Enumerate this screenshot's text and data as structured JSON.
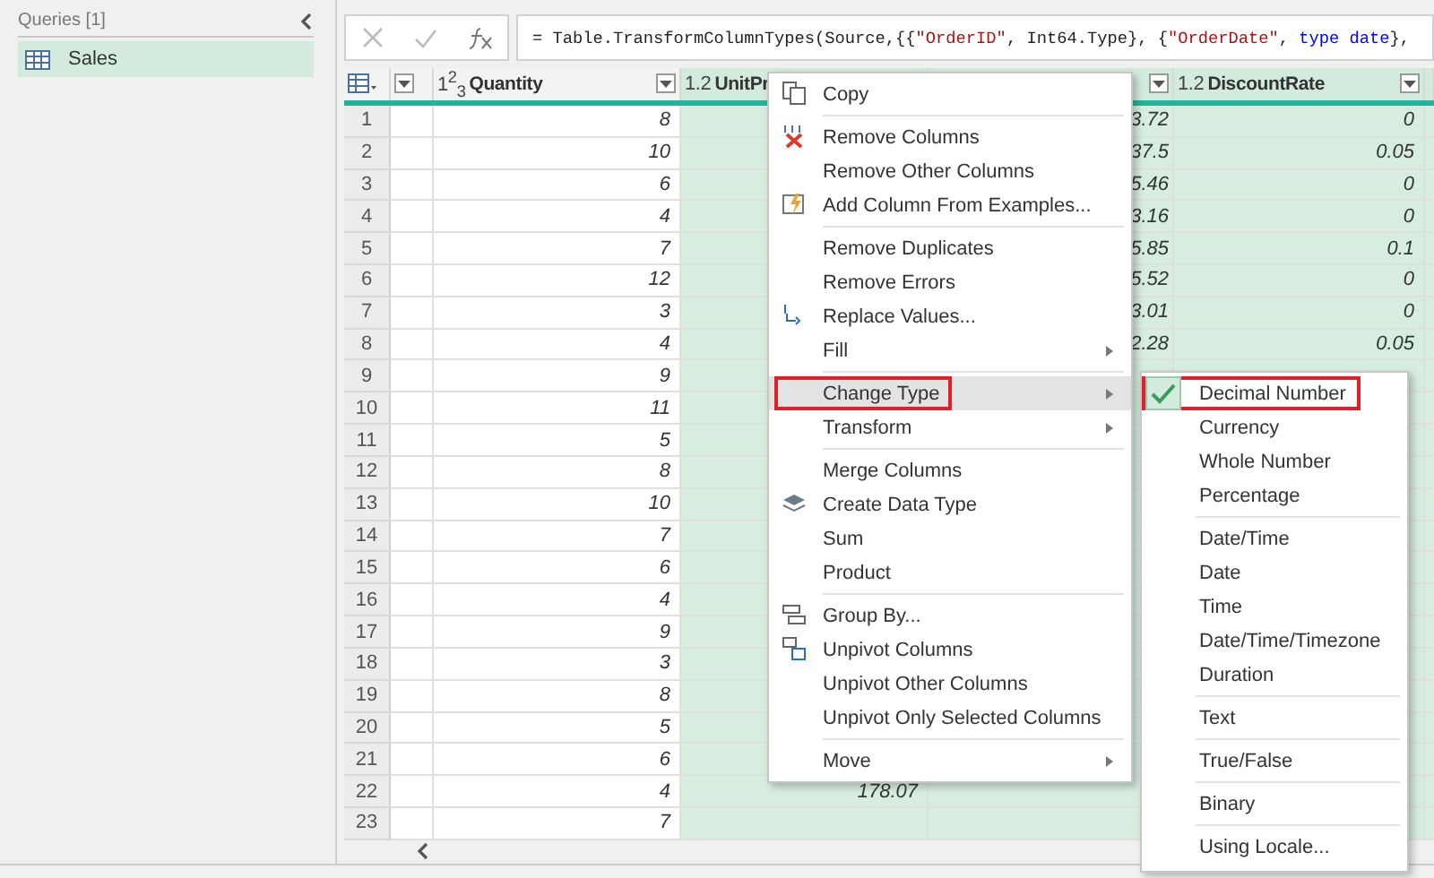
{
  "queries_panel": {
    "title": "Queries [1]",
    "items": [
      {
        "label": "Sales",
        "selected": true
      }
    ]
  },
  "formula_bar": {
    "segments": [
      {
        "kind": "plain",
        "text": "= Table.TransformColumnTypes(Source,{{"
      },
      {
        "kind": "string",
        "text": "\"OrderID\""
      },
      {
        "kind": "plain",
        "text": ", Int64.Type}, {"
      },
      {
        "kind": "string",
        "text": "\"OrderDate\""
      },
      {
        "kind": "plain",
        "text": ", "
      },
      {
        "kind": "keyword",
        "text": "type date"
      },
      {
        "kind": "plain",
        "text": "},"
      }
    ]
  },
  "table": {
    "columns": [
      {
        "type_label": "1$^{2}$$_{3}$",
        "name": "Quantity",
        "selected": false
      },
      {
        "type_label": "1.2",
        "name": "UnitPr",
        "selected": true
      },
      {
        "selected": true
      },
      {
        "type_label": "1.2",
        "name": "DiscountRate",
        "selected": true
      }
    ],
    "rows": [
      {
        "n": "1",
        "cells": [
          "8",
          "",
          "3.72",
          "0"
        ]
      },
      {
        "n": "2",
        "cells": [
          "10",
          "",
          "37.5",
          "0.05"
        ]
      },
      {
        "n": "3",
        "cells": [
          "6",
          "",
          "5.46",
          "0"
        ]
      },
      {
        "n": "4",
        "cells": [
          "4",
          "",
          "3.16",
          "0"
        ]
      },
      {
        "n": "5",
        "cells": [
          "7",
          "",
          "5.85",
          "0.1"
        ]
      },
      {
        "n": "6",
        "cells": [
          "12",
          "",
          "5.52",
          "0"
        ]
      },
      {
        "n": "7",
        "cells": [
          "3",
          "",
          "3.01",
          "0"
        ]
      },
      {
        "n": "8",
        "cells": [
          "4",
          "",
          "2.28",
          "0.05"
        ]
      },
      {
        "n": "9",
        "cells": [
          "9",
          "",
          "",
          ""
        ]
      },
      {
        "n": "10",
        "cells": [
          "11",
          "",
          "",
          ""
        ]
      },
      {
        "n": "11",
        "cells": [
          "5",
          "",
          "",
          ""
        ]
      },
      {
        "n": "12",
        "cells": [
          "8",
          "",
          "",
          ""
        ]
      },
      {
        "n": "13",
        "cells": [
          "10",
          "",
          "",
          ""
        ]
      },
      {
        "n": "14",
        "cells": [
          "7",
          "",
          "",
          ""
        ]
      },
      {
        "n": "15",
        "cells": [
          "6",
          "",
          "",
          ""
        ]
      },
      {
        "n": "16",
        "cells": [
          "4",
          "",
          "",
          ""
        ]
      },
      {
        "n": "17",
        "cells": [
          "9",
          "",
          "",
          ""
        ]
      },
      {
        "n": "18",
        "cells": [
          "3",
          "",
          "",
          ""
        ]
      },
      {
        "n": "19",
        "cells": [
          "8",
          "",
          "",
          ""
        ]
      },
      {
        "n": "20",
        "cells": [
          "5",
          "",
          "",
          ""
        ]
      },
      {
        "n": "21",
        "cells": [
          "6",
          "",
          "",
          ""
        ]
      },
      {
        "n": "22",
        "cells": [
          "4",
          "178.07",
          "",
          ""
        ]
      },
      {
        "n": "23",
        "cells": [
          "7",
          "",
          "",
          ""
        ]
      }
    ]
  },
  "context_menu": {
    "items": [
      {
        "label": "Copy",
        "submenu": false,
        "selected": false,
        "outlined": false,
        "separator_before": false
      },
      {
        "label": "Remove Columns",
        "submenu": false,
        "selected": false,
        "outlined": false,
        "separator_before": true
      },
      {
        "label": "Remove Other Columns",
        "submenu": false,
        "selected": false,
        "outlined": false,
        "separator_before": false
      },
      {
        "label": "Add Column From Examples...",
        "submenu": false,
        "selected": false,
        "outlined": false,
        "separator_before": false
      },
      {
        "label": "Remove Duplicates",
        "submenu": false,
        "selected": false,
        "outlined": false,
        "separator_before": true
      },
      {
        "label": "Remove Errors",
        "submenu": false,
        "selected": false,
        "outlined": false,
        "separator_before": false
      },
      {
        "label": "Replace Values...",
        "submenu": false,
        "selected": false,
        "outlined": false,
        "separator_before": false
      },
      {
        "label": "Fill",
        "submenu": true,
        "selected": false,
        "outlined": false,
        "separator_before": false
      },
      {
        "label": "Change Type",
        "submenu": true,
        "selected": true,
        "outlined": true,
        "separator_before": true
      },
      {
        "label": "Transform",
        "submenu": true,
        "selected": false,
        "outlined": false,
        "separator_before": false
      },
      {
        "label": "Merge Columns",
        "submenu": false,
        "selected": false,
        "outlined": false,
        "separator_before": true
      },
      {
        "label": "Create Data Type",
        "submenu": false,
        "selected": false,
        "outlined": false,
        "separator_before": false
      },
      {
        "label": "Sum",
        "submenu": false,
        "selected": false,
        "outlined": false,
        "separator_before": false
      },
      {
        "label": "Product",
        "submenu": false,
        "selected": false,
        "outlined": false,
        "separator_before": false
      },
      {
        "label": "Group By...",
        "submenu": false,
        "selected": false,
        "outlined": false,
        "separator_before": true
      },
      {
        "label": "Unpivot Columns",
        "submenu": false,
        "selected": false,
        "outlined": false,
        "separator_before": false
      },
      {
        "label": "Unpivot Other Columns",
        "submenu": false,
        "selected": false,
        "outlined": false,
        "separator_before": false
      },
      {
        "label": "Unpivot Only Selected Columns",
        "submenu": false,
        "selected": false,
        "outlined": false,
        "separator_before": false
      },
      {
        "label": "Move",
        "submenu": true,
        "selected": false,
        "outlined": false,
        "separator_before": true
      }
    ]
  },
  "type_submenu": {
    "items": [
      {
        "label": "Decimal Number",
        "checked": true,
        "outlined": true,
        "separator_before": false
      },
      {
        "label": "Currency",
        "checked": false,
        "outlined": false,
        "separator_before": false
      },
      {
        "label": "Whole Number",
        "checked": false,
        "outlined": false,
        "separator_before": false
      },
      {
        "label": "Percentage",
        "checked": false,
        "outlined": false,
        "separator_before": false
      },
      {
        "label": "Date/Time",
        "checked": false,
        "outlined": false,
        "separator_before": true
      },
      {
        "label": "Date",
        "checked": false,
        "outlined": false,
        "separator_before": false
      },
      {
        "label": "Time",
        "checked": false,
        "outlined": false,
        "separator_before": false
      },
      {
        "label": "Date/Time/Timezone",
        "checked": false,
        "outlined": false,
        "separator_before": false
      },
      {
        "label": "Duration",
        "checked": false,
        "outlined": false,
        "separator_before": false
      },
      {
        "label": "Text",
        "checked": false,
        "outlined": false,
        "separator_before": true
      },
      {
        "label": "True/False",
        "checked": false,
        "outlined": false,
        "separator_before": true
      },
      {
        "label": "Binary",
        "checked": false,
        "outlined": false,
        "separator_before": true
      },
      {
        "label": "Using Locale...",
        "checked": false,
        "outlined": false,
        "separator_before": true
      }
    ]
  }
}
